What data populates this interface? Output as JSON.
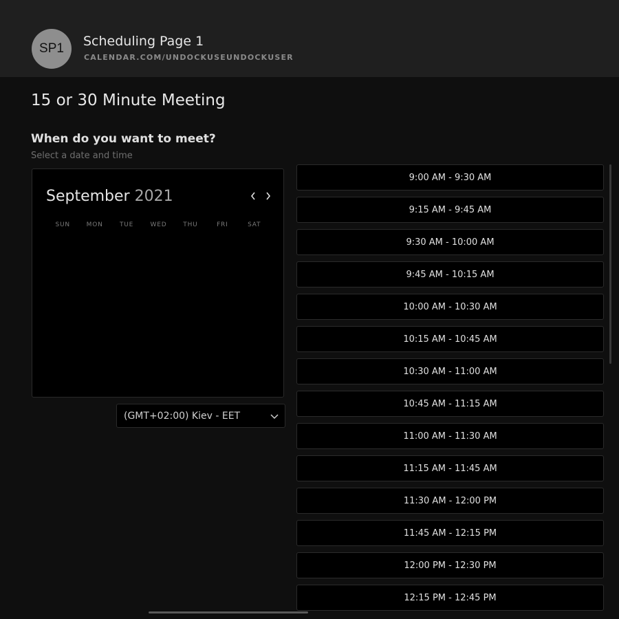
{
  "header": {
    "avatar_initials": "SP1",
    "title": "Scheduling Page 1",
    "url": "CALENDAR.COM/UNDOCKUSEUNDOCKUSER"
  },
  "meeting": {
    "title": "15 or 30 Minute Meeting"
  },
  "prompt": {
    "question": "When do you want to meet?",
    "subtext": "Select a date and time"
  },
  "calendar": {
    "month": "September",
    "year": "2021",
    "prev_icon": "chevron-left-icon",
    "next_icon": "chevron-right-icon",
    "weekdays": [
      "SUN",
      "MON",
      "TUE",
      "WED",
      "THU",
      "FRI",
      "SAT"
    ]
  },
  "timezone": {
    "selected": "(GMT+02:00) Kiev - EET",
    "icon": "chevron-down-icon"
  },
  "time_slots": [
    "9:00 AM - 9:30 AM",
    "9:15 AM - 9:45 AM",
    "9:30 AM - 10:00 AM",
    "9:45 AM - 10:15 AM",
    "10:00 AM - 10:30 AM",
    "10:15 AM - 10:45 AM",
    "10:30 AM - 11:00 AM",
    "10:45 AM - 11:15 AM",
    "11:00 AM - 11:30 AM",
    "11:15 AM - 11:45 AM",
    "11:30 AM - 12:00 PM",
    "11:45 AM - 12:15 PM",
    "12:00 PM - 12:30 PM",
    "12:15 PM - 12:45 PM"
  ],
  "colors": {
    "page_background": "#0f0f0f",
    "header_background": "#1f1f1f",
    "slot_background": "#000000",
    "avatar_background": "#8e8e8e"
  }
}
